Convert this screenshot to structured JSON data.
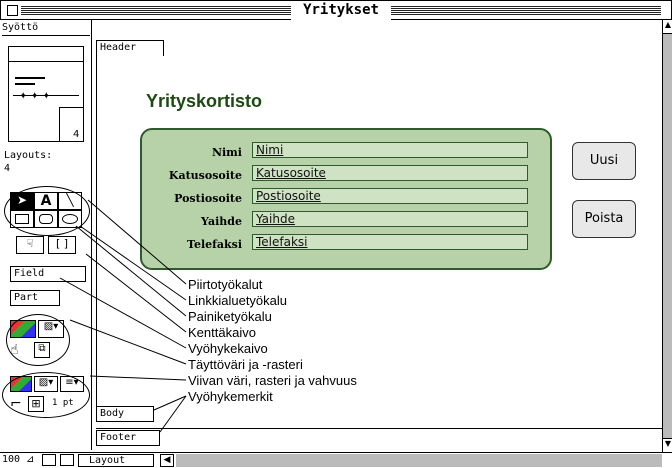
{
  "window": {
    "title": "Yritykset"
  },
  "tools": {
    "mode_label": "Syöttö",
    "page_count": "4",
    "layouts_label": "Layouts:",
    "layouts_count": "4",
    "field_tool": "Field",
    "part_tool": "Part",
    "line_width": "1 pt"
  },
  "layout": {
    "header_tag": "Header",
    "body_tag": "Body",
    "footer_tag": "Footer",
    "heading": "Yrityskortisto",
    "fields": [
      {
        "label": "Nimi",
        "value": "Nimi"
      },
      {
        "label": "Katusosoite",
        "value": "Katusosoite"
      },
      {
        "label": "Postiosoite",
        "value": "Postiosoite"
      },
      {
        "label": "Yaihde",
        "value": "Yaihde"
      },
      {
        "label": "Telefaksi",
        "value": "Telefaksi"
      }
    ],
    "button_new": "Uusi",
    "button_delete": "Poista"
  },
  "annotations": [
    "Piirtotyökalut",
    "Linkkialuetyökalu",
    "Painiketyökalu",
    "Kenttäkaivo",
    "Vyöhykekaivo",
    "Täyttöväri ja -rasteri",
    "Viivan väri, rasteri ja vahvuus",
    "Vyöhykemerkit"
  ],
  "statusbar": {
    "zoom": "100",
    "mode": "Layout"
  },
  "colors": {
    "panel_fill": "#b7d2a8",
    "panel_border": "#2e5a2e",
    "field_fill": "#cfe3c4"
  }
}
